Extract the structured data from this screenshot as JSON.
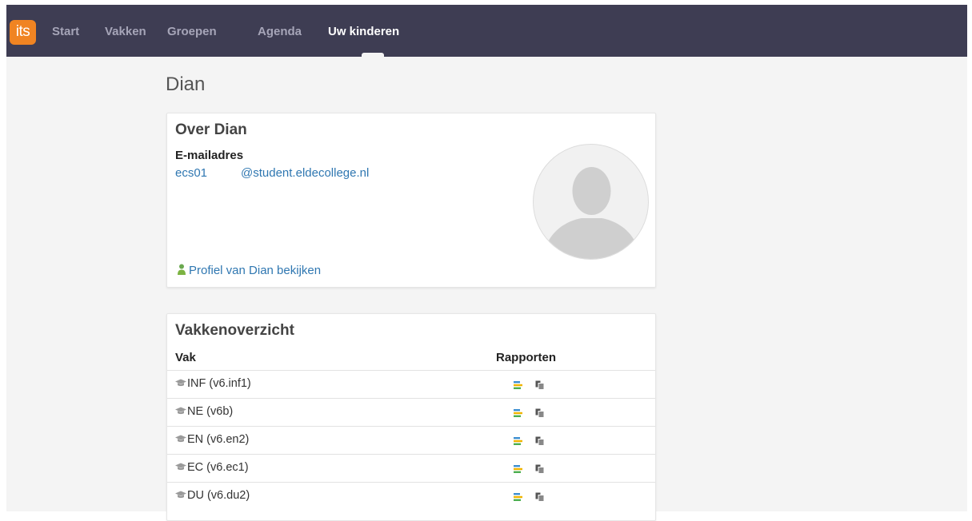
{
  "nav": {
    "logo": "its",
    "items": [
      {
        "label": "Start",
        "active": false
      },
      {
        "label": "Vakken",
        "active": false
      },
      {
        "label": "Groepen",
        "active": false
      },
      {
        "label": "Agenda",
        "active": false
      },
      {
        "label": "Uw kinderen",
        "active": true
      }
    ]
  },
  "page": {
    "title": "Dian"
  },
  "about": {
    "title": "Over Dian",
    "email_label": "E-mailadres",
    "email_user": "ecs01",
    "email_domain": "@student.eldecollege.nl",
    "profile_link": "Profiel van Dian bekijken"
  },
  "courses": {
    "title": "Vakkenoverzicht",
    "col_course": "Vak",
    "col_reports": "Rapporten",
    "rows": [
      {
        "name": "INF (v6.inf1)"
      },
      {
        "name": "NE (v6b)"
      },
      {
        "name": "EN (v6.en2)"
      },
      {
        "name": "EC (v6.ec1)"
      },
      {
        "name": "DU (v6.du2)"
      }
    ]
  },
  "colors": {
    "navbar": "#3e3d53",
    "logo": "#f08422",
    "link": "#2f77b1",
    "background": "#f4f4f4"
  },
  "icons": [
    "person-icon",
    "graduation-cap-icon",
    "report-bars-icon",
    "report-copy-icon",
    "default-avatar-icon"
  ]
}
